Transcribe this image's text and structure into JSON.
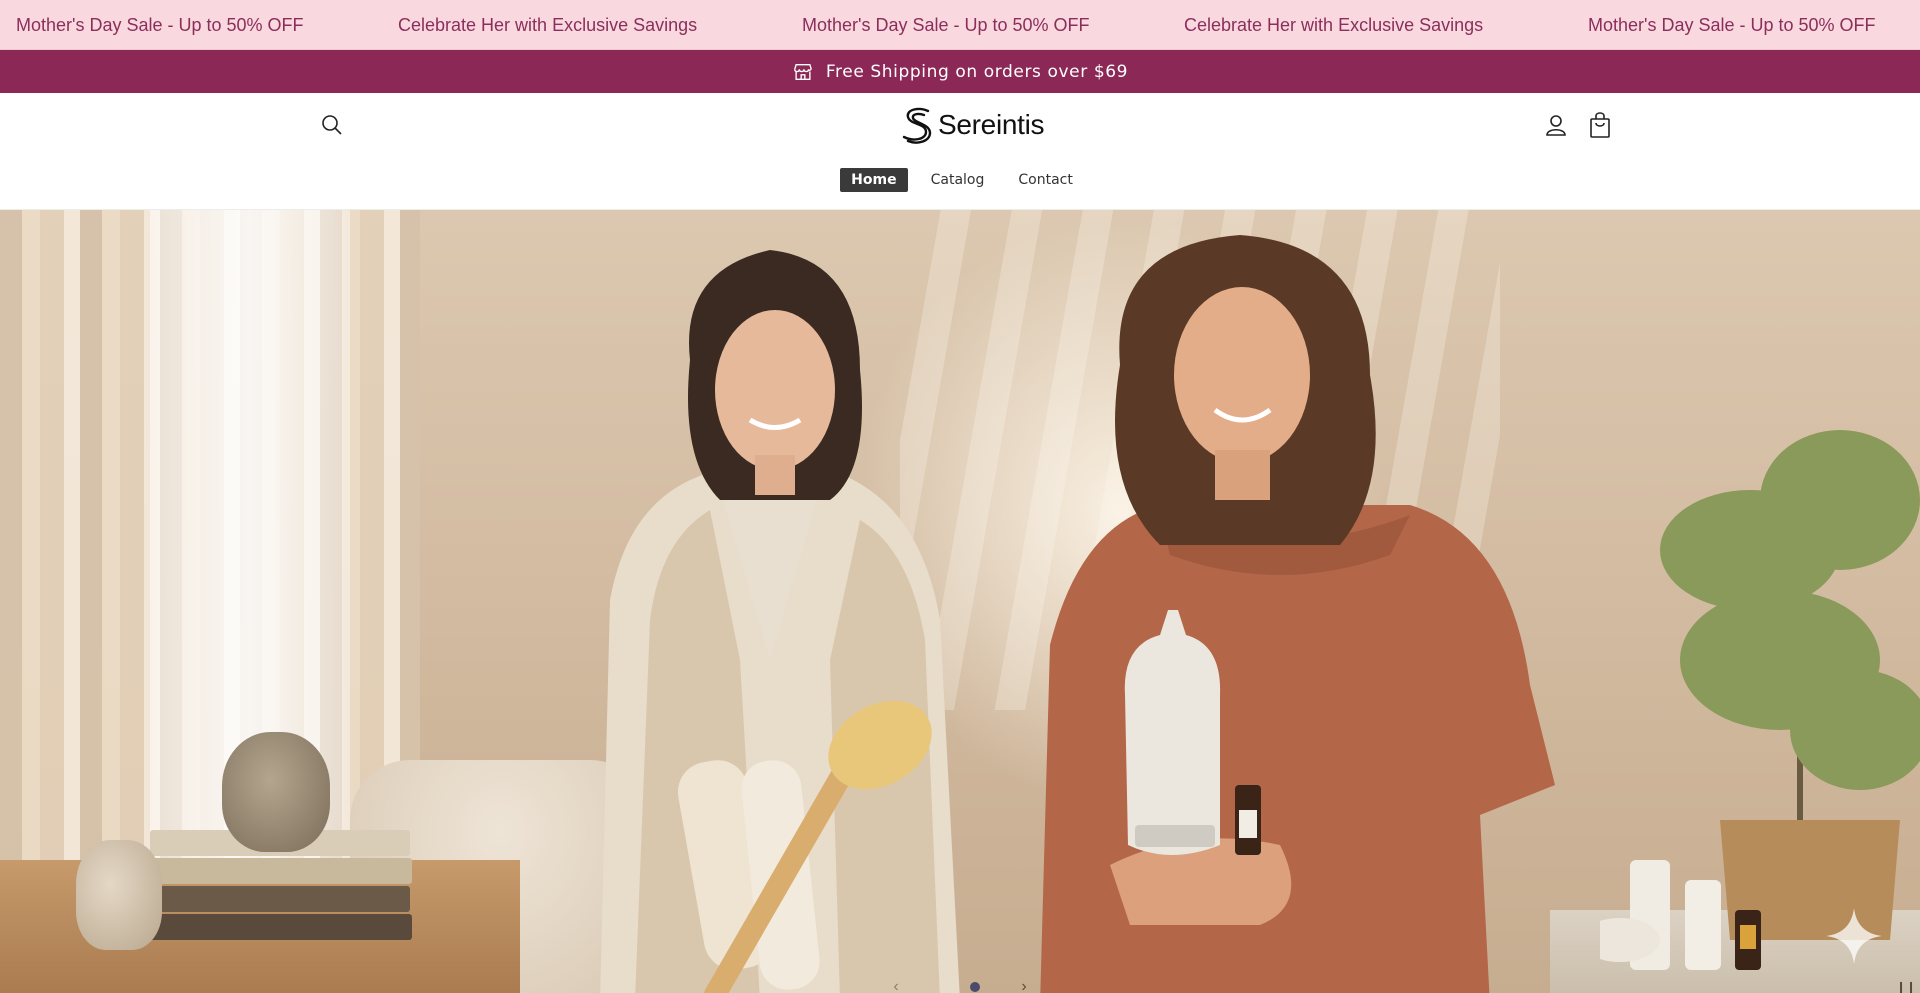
{
  "marquee": {
    "items": [
      "Mother's Day Sale - Up to 50% OFF",
      "Celebrate Her with Exclusive Savings",
      "Mother's Day Sale - Up to 50% OFF",
      "Celebrate Her with Exclusive Savings",
      "Mother's Day Sale - Up to 50% OFF"
    ]
  },
  "shipping": {
    "icon": "store-icon",
    "text": "Free Shipping on orders over $69"
  },
  "header": {
    "brand": "Sereintis",
    "icons": [
      "search-icon",
      "account-icon",
      "cart-icon"
    ],
    "nav": [
      {
        "label": "Home",
        "active": true
      },
      {
        "label": "Catalog",
        "active": false
      },
      {
        "label": "Contact",
        "active": false
      }
    ]
  },
  "hero": {
    "slider_prev": "‹",
    "slider_next": "›",
    "pause": "❙❙"
  },
  "colors": {
    "marquee_bg": "#f9d8e0",
    "marquee_text": "#8b2f5a",
    "shipping_bg": "#8b2856",
    "nav_active_bg": "#3a3a3a"
  }
}
